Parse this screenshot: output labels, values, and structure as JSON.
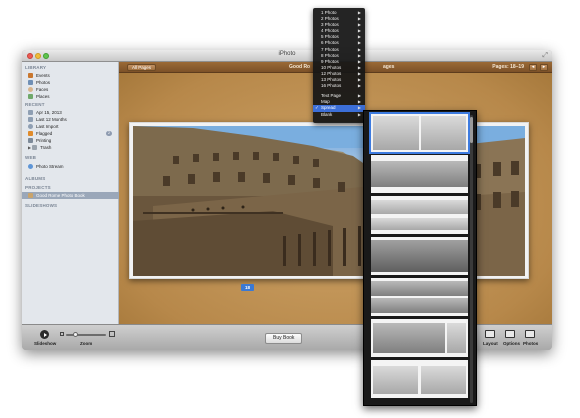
{
  "window": {
    "title": "iPhoto"
  },
  "sidebar": {
    "sections": {
      "library": "LIBRARY",
      "recent": "RECENT",
      "web": "WEB",
      "albums": "ALBUMS",
      "projects": "PROJECTS",
      "slideshows": "SLIDESHOWS"
    },
    "library_items": [
      "Events",
      "Photos",
      "Faces",
      "Places"
    ],
    "recent_items": [
      "Apr 15, 2013",
      "Last 12 Months",
      "Last Import",
      "Flagged",
      "Printing",
      "Trash"
    ],
    "flagged_count": "2",
    "web_items": [
      "Photo Stream"
    ],
    "project_items": [
      "Good Rome Photo Book"
    ]
  },
  "content": {
    "all_pages_button": "All Pages",
    "book_title_start": "Good Ro",
    "book_title_end": "ages",
    "pages_label": "Pages: 18–19",
    "page_number": "18"
  },
  "toolbar": {
    "slideshow_label": "Slideshow",
    "zoom_label": "Zoom",
    "buy_book_label": "Buy Book",
    "layout_label": "Layout",
    "options_label": "Options",
    "photos_label": "Photos",
    "zoom_level": 0.25
  },
  "menu": {
    "photo_items": [
      "1 Photo",
      "2 Photos",
      "3 Photos",
      "4 Photos",
      "5 Photos",
      "6 Photos",
      "7 Photos",
      "8 Photos",
      "9 Photos",
      "10 Photos",
      "12 Photos",
      "13 Photos",
      "16 Photos"
    ],
    "other_items": [
      "Text Page",
      "Map",
      "Spread",
      "Blank"
    ],
    "checked_item": "Spread"
  },
  "colors": {
    "selection_blue": "#3d7be0",
    "book_background": "#b7884a",
    "menu_background": "#161616"
  }
}
